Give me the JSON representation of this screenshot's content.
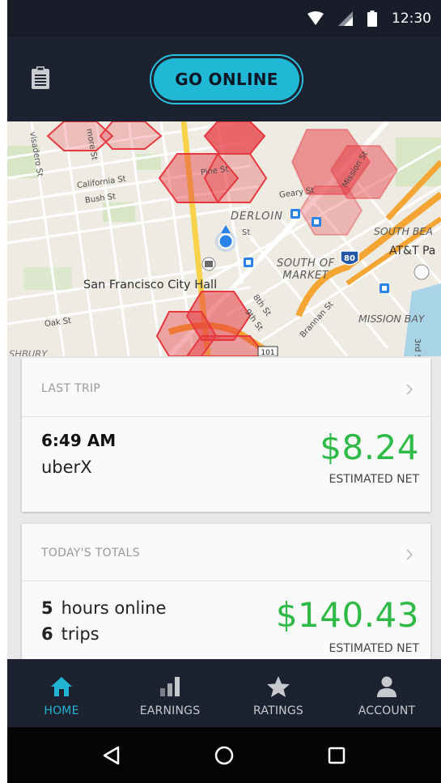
{
  "status_bar": {
    "time": "12:30",
    "icons": [
      "wifi-icon",
      "signal-icon",
      "battery-icon"
    ]
  },
  "top_bar": {
    "go_online_label": "GO ONLINE",
    "left_icon": "clipboard-icon"
  },
  "map": {
    "labels": {
      "city_hall": "San Francisco City Hall",
      "california_st": "California St",
      "bush_st": "Bush St",
      "pine_st": "Pine St",
      "geary_st": "Geary St",
      "oak_st": "Oak St",
      "derloin": "DERLOIN",
      "south_of_market": "SOUTH OF\nMARKET",
      "south_beach": "SOUTH BEA",
      "att_park": "AT&T Pa",
      "mission_bay": "MISSION BAY",
      "shbury": "SHBURY",
      "divisadero": "visadero St",
      "fillmore": "more St",
      "mission_st": "Mission St",
      "eighth_st": "8th St",
      "ninth_st": "9th St",
      "brannan_st": "Brannan St",
      "third_st": "3rd S",
      "st_near_location": "St",
      "interstate": "80",
      "highway": "101"
    }
  },
  "last_trip": {
    "header": "LAST TRIP",
    "time": "6:49 AM",
    "type": "uberX",
    "amount": "$8.24",
    "caption": "ESTIMATED NET"
  },
  "todays_totals": {
    "header": "TODAY'S TOTALS",
    "hours_value": "5",
    "hours_label": "hours online",
    "trips_value": "6",
    "trips_label": "trips",
    "amount": "$140.43",
    "caption": "ESTIMATED NET"
  },
  "bottom_nav": {
    "items": [
      {
        "label": "HOME",
        "icon": "home-icon",
        "active": true
      },
      {
        "label": "EARNINGS",
        "icon": "bar-chart-icon",
        "active": false
      },
      {
        "label": "RATINGS",
        "icon": "star-icon",
        "active": false
      },
      {
        "label": "ACCOUNT",
        "icon": "person-icon",
        "active": false
      }
    ]
  },
  "system_nav": {
    "icons": [
      "back-icon",
      "home-circle-icon",
      "recents-icon"
    ]
  },
  "colors": {
    "accent": "#21b8d6",
    "money_green": "#2fba48",
    "dark_bar": "#1d2231",
    "surge_red": "#e5383f"
  }
}
